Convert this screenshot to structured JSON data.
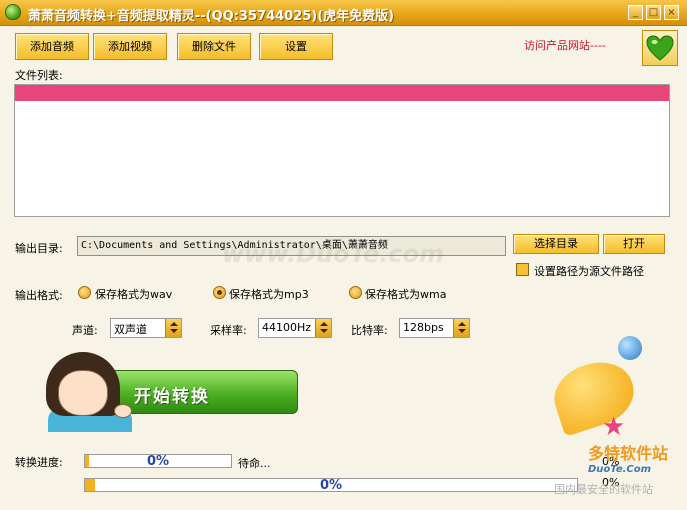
{
  "window": {
    "title": "萧萧音频转换+音频提取精灵--(QQ:35744025)(虎年免费版)",
    "min_label": "_",
    "max_label": "□",
    "close_label": "×"
  },
  "toolbar": {
    "add_audio": "添加音频",
    "add_video": "添加视频",
    "delete_file": "删除文件",
    "settings": "设置",
    "visit_link": "访问产品网站----"
  },
  "file_list": {
    "label": "文件列表:"
  },
  "output": {
    "dir_label": "输出目录:",
    "dir_value": "C:\\Documents and Settings\\Administrator\\桌面\\萧萧音频",
    "choose_dir": "选择目录",
    "open": "打开",
    "use_source_path": "设置路径为源文件路径",
    "use_source_path_checked": false,
    "format_label": "输出格式:",
    "formats": [
      "保存格式为wav",
      "保存格式为mp3",
      "保存格式为wma"
    ],
    "selected_format": "保存格式为mp3"
  },
  "params": {
    "channel_label": "声道:",
    "channel_value": "双声道",
    "samplerate_label": "采样率:",
    "samplerate_value": "44100Hz",
    "bitrate_label": "比特率:",
    "bitrate_value": "128bps"
  },
  "start": {
    "label": "开始转换"
  },
  "progress": {
    "label": "转换进度:",
    "file_progress": "0%",
    "file_fraction": 0.03,
    "status": "待命...",
    "total_progress": "0%",
    "total_fraction": 0.02,
    "right_top": "0%",
    "right_bottom": "0%"
  },
  "watermark": {
    "center": "www.DuoTe.com",
    "logo": "多特软件站",
    "url": "DuoTe.Com",
    "slogan": "国内最安全的软件站"
  },
  "colors": {
    "accent": "#f5bd2a",
    "list_highlight": "#e8457a",
    "start_button": "#4caf22",
    "progress_text": "#2547a5"
  }
}
